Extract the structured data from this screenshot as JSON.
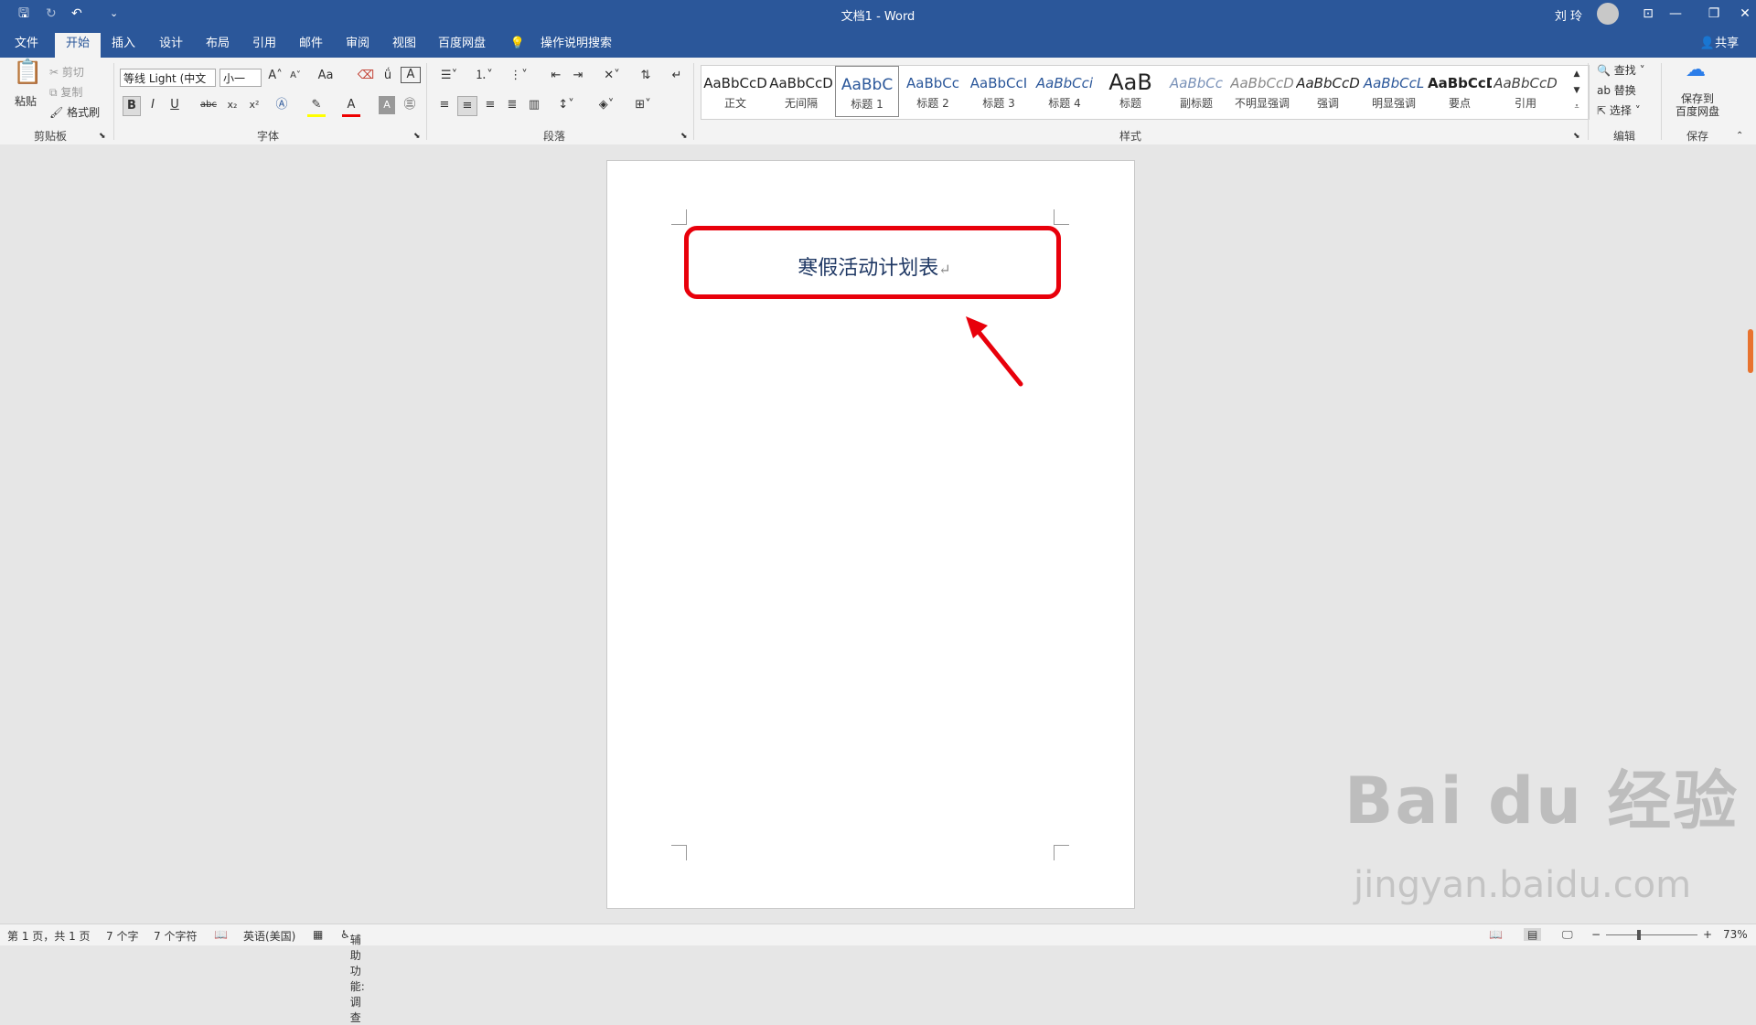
{
  "titlebar": {
    "title": "文档1  -  Word",
    "user": "刘 玲",
    "save_icon": "save-icon",
    "undo": "↶",
    "redo": "↻",
    "customize": "⌄",
    "ribbon_options": "⊡",
    "minimize": "—",
    "restore": "❐",
    "close": "✕"
  },
  "tabs": [
    "文件",
    "开始",
    "插入",
    "设计",
    "布局",
    "引用",
    "邮件",
    "审阅",
    "视图",
    "百度网盘"
  ],
  "tell_me": "操作说明搜索",
  "share": "共享",
  "clipboard": {
    "paste": "粘贴",
    "cut": "剪切",
    "copy": "复制",
    "format_painter": "格式刷",
    "label": "剪贴板"
  },
  "font": {
    "name": "等线 Light (中文",
    "size": "小一",
    "label": "字体",
    "grow": "A˄",
    "shrink": "A˅",
    "case": "Aa",
    "bold": "B",
    "italic": "I",
    "underline": "U",
    "strike": "abc",
    "sub": "x₂",
    "sup": "x²"
  },
  "paragraph": {
    "label": "段落"
  },
  "styles": {
    "label": "样式",
    "items": [
      {
        "preview": "AaBbCcD",
        "name": "正文",
        "color": "#222222"
      },
      {
        "preview": "AaBbCcD",
        "name": "无间隔",
        "color": "#222222"
      },
      {
        "preview": "AaBbC",
        "name": "标题 1",
        "color": "#2b579a"
      },
      {
        "preview": "AaBbCc",
        "name": "标题 2",
        "color": "#2b579a"
      },
      {
        "preview": "AaBbCcI",
        "name": "标题 3",
        "color": "#2b579a"
      },
      {
        "preview": "AaBbCci",
        "name": "标题 4",
        "color": "#2b579a"
      },
      {
        "preview": "AaB",
        "name": "标题",
        "color": "#222222"
      },
      {
        "preview": "AaBbCc",
        "name": "副标题",
        "color": "#7a92b8"
      },
      {
        "preview": "AaBbCcD",
        "name": "不明显强调",
        "color": "#888888"
      },
      {
        "preview": "AaBbCcD",
        "name": "强调",
        "color": "#333333"
      },
      {
        "preview": "AaBbCcL",
        "name": "明显强调",
        "color": "#2b579a"
      },
      {
        "preview": "AaBbCcD",
        "name": "要点",
        "color": "#111111"
      },
      {
        "preview": "AaBbCcD",
        "name": "引用",
        "color": "#444444"
      }
    ]
  },
  "editing": {
    "find": "查找",
    "replace": "替换",
    "select": "选择",
    "label": "编辑"
  },
  "save_group": {
    "button": "保存到\n百度网盘",
    "label": "保存"
  },
  "document": {
    "heading": "寒假活动计划表",
    "pilcrow": "↵"
  },
  "status": {
    "page": "第 1 页，共 1 页",
    "words": "7 个字",
    "chars": "7 个字符",
    "lang": "英语(美国)",
    "accessibility": "辅助功能: 调查",
    "zoom": "73%"
  },
  "watermark": {
    "main": "Bai du 经验",
    "sub": "jingyan.baidu.com"
  },
  "accent": "#2b579a",
  "highlight_color": "#e8000b"
}
